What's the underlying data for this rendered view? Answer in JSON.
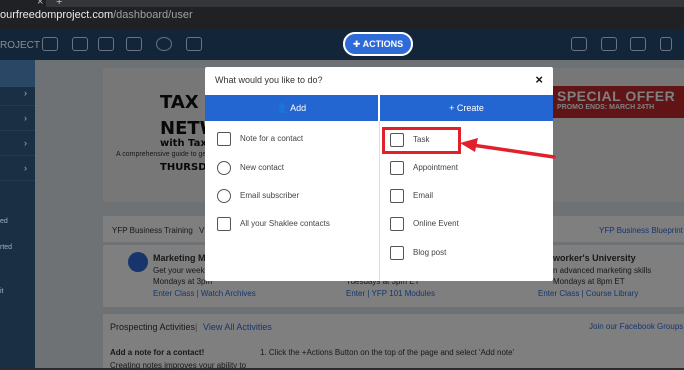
{
  "browser": {
    "url_domain": "ourfreedomproject.com",
    "url_path": "/dashboard/user"
  },
  "app": {
    "brand": "ROJECT",
    "actions_label": "ACTIONS"
  },
  "sidebar": {
    "texts": [
      "ed",
      "rted",
      "it"
    ]
  },
  "banner": {
    "title_line1": "TAX FU",
    "title_line2": "NETWO",
    "title_line3": "with Tax",
    "subtitle": "A comprehensive guide to ge",
    "day": "THURSDAY",
    "special_big": "SPECIAL OFFER",
    "special_small": "PROMO ENDS: MARCH 24TH"
  },
  "tabs": {
    "left": "YFP Business Training",
    "left_trunc": "V",
    "right": "YFP Business Blueprint"
  },
  "cards": {
    "left_title": "Marketing M",
    "left_line1": "Get your week's",
    "left_line2": "Mondays at 3pm",
    "left_links": "Enter Class | Watch Archives",
    "mid_line": "Tuesdays at 3pm ET",
    "mid_links": "Enter | YFP 101 Modules",
    "right_title": "worker's University",
    "right_line1": "n advanced marketing skills",
    "right_line2": "Mondays at 8pm ET",
    "right_links": "Enter Class | Course Library"
  },
  "prospecting": {
    "title": "Prospecting Activities",
    "view_all": "View All Activities",
    "fb": "Join our Facebook Groups",
    "add_note": "Add a note for a contact!",
    "creating": "Creating notes improves your ability to",
    "step": "1. Click the +Actions Button on the top of the page and select 'Add note'"
  },
  "modal": {
    "title": "What would you like to do?",
    "close": "×",
    "add_header": "Add",
    "create_header": "+ Create",
    "add_items": [
      "Note for a contact",
      "New contact",
      "Email subscriber",
      "All your Shaklee contacts"
    ],
    "create_items": [
      "Task",
      "Appointment",
      "Email",
      "Online Event",
      "Blog post"
    ]
  },
  "colors": {
    "accent": "#2366d1",
    "highlight": "#e0202a",
    "navy": "#1e3a56"
  }
}
